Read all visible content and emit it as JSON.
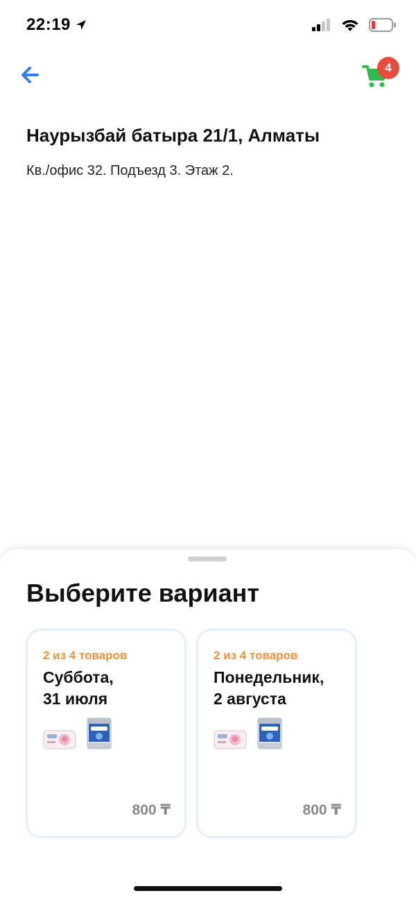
{
  "status_bar": {
    "time": "22:19",
    "icons": [
      "location-arrow-icon",
      "cellular-signal-icon",
      "wifi-icon",
      "battery-icon"
    ]
  },
  "nav": {
    "back_icon": "arrow-left-icon",
    "cart_icon": "shopping-cart-icon",
    "cart_badge": "4"
  },
  "address": {
    "title": "Наурызбай батыра 21/1, Алматы",
    "details": "Кв./офис 32. Подъезд 3. Этаж 2."
  },
  "sheet": {
    "title": "Выберите вариант",
    "options": [
      {
        "count": "2 из 4 товаров",
        "date_line1": "Суббота,",
        "date_line2": "31 июля",
        "products": [
          "wet-wipes-pack",
          "nutrilon-formula-can"
        ],
        "price": "800 ₸"
      },
      {
        "count": "2 из 4 товаров",
        "date_line1": "Понедельник,",
        "date_line2": "2 августа",
        "products": [
          "wet-wipes-pack",
          "nutrilon-formula-can"
        ],
        "price": "800 ₸"
      }
    ]
  },
  "colors": {
    "accent_blue": "#2f80ed",
    "cart_green": "#2dbd4e",
    "badge_red": "#e74c3c",
    "count_orange": "#f0923c",
    "price_gray": "#888888",
    "card_border": "#e5eefb"
  }
}
